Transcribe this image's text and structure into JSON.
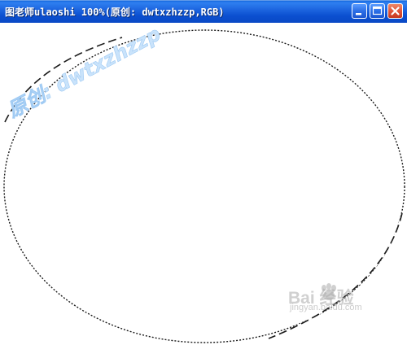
{
  "window": {
    "title": "图老师ulaoshi 100%(原创: dwtxzhzzp,RGB)",
    "controls": {
      "minimize_icon": "minimize-icon",
      "maximize_icon": "maximize-icon",
      "close_icon": "close-icon"
    }
  },
  "canvas": {
    "background": "#ffffff",
    "selection": "elliptical-marquee"
  },
  "watermarks": {
    "author": "原创: dwtxzhzzp",
    "baidu_text": "Bai 经验",
    "baidu_url": "jingyan.baidu.com",
    "site_logo": "图老师"
  },
  "colors": {
    "titlebar": "#1b63de",
    "close_button": "#e0553a",
    "watermark_blue": "#c9e3fb"
  }
}
